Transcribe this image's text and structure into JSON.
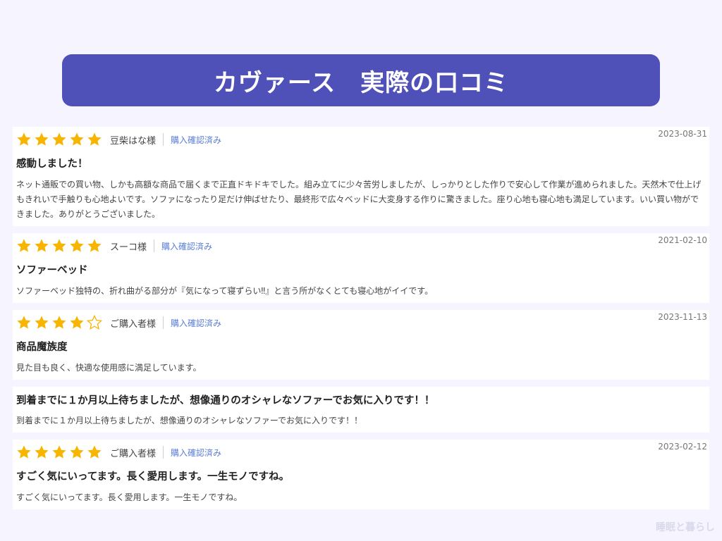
{
  "banner": {
    "title": "カヴァース　実際の口コミ"
  },
  "colors": {
    "banner_bg": "#4f50b8",
    "star_fill": "#f7b500",
    "star_empty": "#f7b500",
    "verified": "#5b7fd6"
  },
  "reviews": [
    {
      "rating": 5,
      "reviewer": "豆柴はな様",
      "verified": "購入確認済み",
      "date": "2023-08-31",
      "title": "感動しました！",
      "body": "ネット通販での買い物、しかも高額な商品で届くまで正直ドキドキでした。組み立てに少々苦労しましたが、しっかりとした作りで安心して作業が進められました。天然木で仕上げもきれいで手触りも心地よいです。ソファになったり足だけ伸ばせたり、最終形で広々ベッドに大変身する作りに驚きました。座り心地も寝心地も満足しています。いい買い物ができました。ありがとうございました。"
    },
    {
      "rating": 5,
      "reviewer": "スーコ様",
      "verified": "購入確認済み",
      "date": "2021-02-10",
      "title": "ソファーベッド",
      "body": "ソファーベッド独特の、折れ曲がる部分が『気になって寝ずらい‼』と言う所がなくとても寝心地がイイです。"
    },
    {
      "rating": 4,
      "reviewer": "ご購入者様",
      "verified": "購入確認済み",
      "date": "2023-11-13",
      "title": "商品魔族度",
      "body": "見た目も良く、快適な使用感に満足しています。"
    },
    {
      "rating": 0,
      "reviewer": "",
      "verified": "",
      "date": "",
      "title": "到着までに１か月以上待ちましたが、想像通りのオシャレなソファーでお気に入りです！！",
      "body": "到着までに１か月以上待ちましたが、想像通りのオシャレなソファーでお気に入りです！！"
    },
    {
      "rating": 5,
      "reviewer": "ご購入者様",
      "verified": "購入確認済み",
      "date": "2023-02-12",
      "title": "すごく気にいってます。長く愛用します。一生モノですね。",
      "body": "すごく気にいってます。長く愛用します。一生モノですね。"
    }
  ],
  "watermark": "睡眠と暮らし"
}
